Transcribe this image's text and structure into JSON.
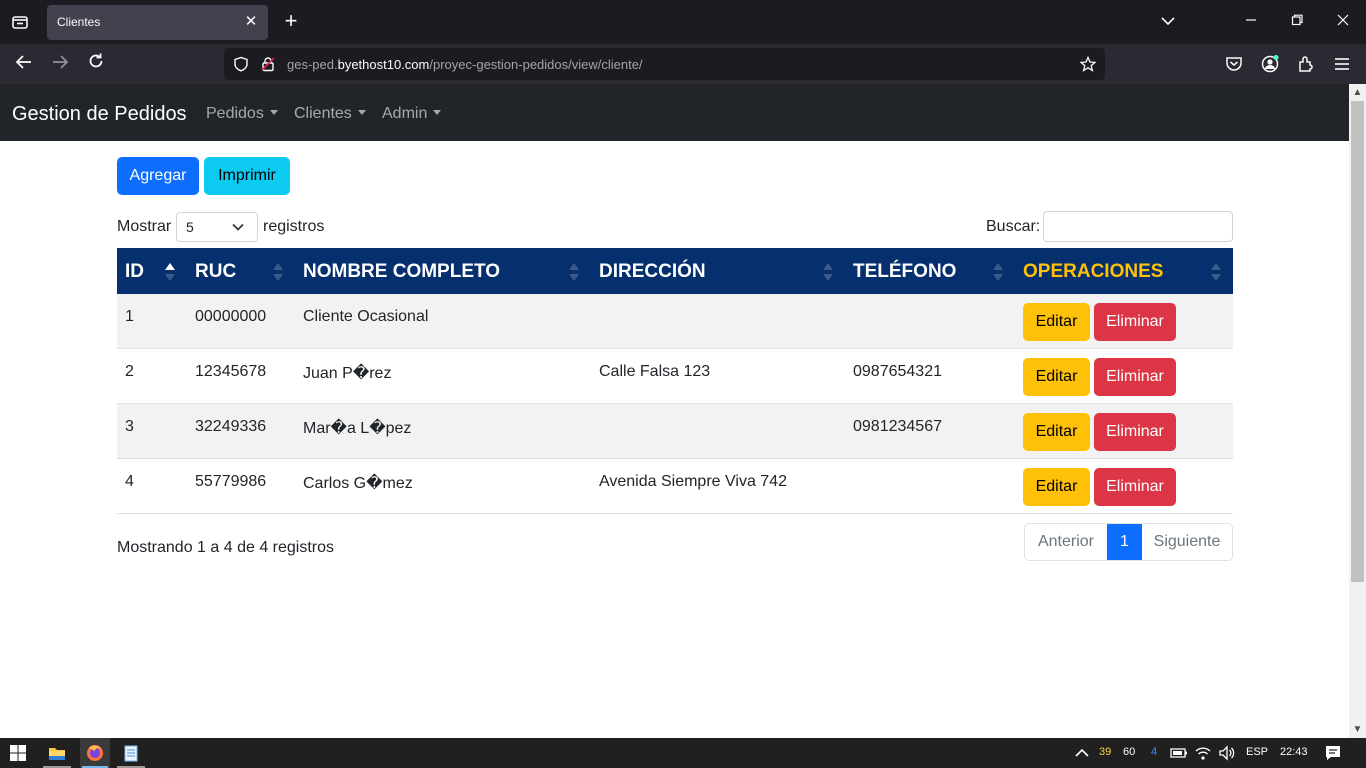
{
  "browser": {
    "tab_title": "Clientes",
    "url_prefix": "ges-ped.",
    "url_domain": "byethost10.com",
    "url_path": "/proyec-gestion-pedidos/view/cliente/"
  },
  "app": {
    "brand": "Gestion de Pedidos",
    "menu": [
      "Pedidos",
      "Clientes",
      "Admin"
    ]
  },
  "actions": {
    "add_label": "Agregar",
    "print_label": "Imprimir"
  },
  "length_control": {
    "prefix": "Mostrar",
    "value": "5",
    "suffix": "registros"
  },
  "search": {
    "label": "Buscar:",
    "value": ""
  },
  "table": {
    "columns": [
      "ID",
      "RUC",
      "NOMBRE COMPLETO",
      "DIRECCIÓN",
      "TELÉFONO",
      "OPERACIONES"
    ],
    "rows": [
      {
        "id": "1",
        "ruc": "00000000",
        "nombre": "Cliente Ocasional",
        "direccion": "",
        "telefono": ""
      },
      {
        "id": "2",
        "ruc": "12345678",
        "nombre": "Juan P�rez",
        "direccion": "Calle Falsa 123",
        "telefono": "0987654321"
      },
      {
        "id": "3",
        "ruc": "32249336",
        "nombre": "Mar�a L�pez",
        "direccion": "",
        "telefono": "0981234567"
      },
      {
        "id": "4",
        "ruc": "55779986",
        "nombre": "Carlos G�mez",
        "direccion": "Avenida Siempre Viva 742",
        "telefono": ""
      }
    ],
    "edit_label": "Editar",
    "delete_label": "Eliminar"
  },
  "footer": {
    "info": "Mostrando 1 a 4 de 4 registros",
    "prev_label": "Anterior",
    "current_page": "1",
    "next_label": "Siguiente"
  },
  "taskbar": {
    "tray_num1": "39",
    "tray_num2": "60",
    "tray_num3": "4",
    "lang": "ESP",
    "time": "22:43"
  }
}
